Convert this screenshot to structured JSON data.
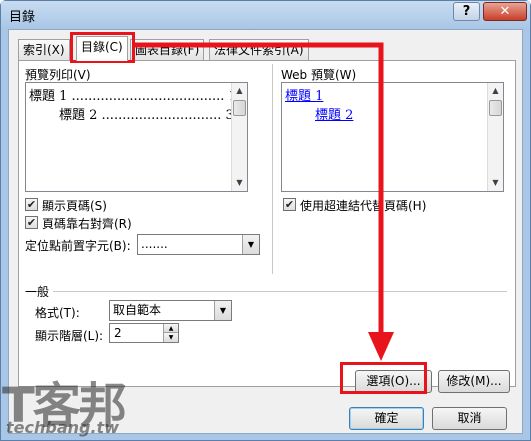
{
  "window": {
    "title": "目錄",
    "help_label": "?",
    "close_label": "✕"
  },
  "tabs": [
    {
      "label": "索引(X)"
    },
    {
      "label": "目錄(C)"
    },
    {
      "label": "圖表目錄(F)"
    },
    {
      "label": "法律文件索引(A)"
    }
  ],
  "print_preview": {
    "label": "預覽列印(V)",
    "entries": [
      {
        "text": "標題 1",
        "dots": ".....................................",
        "page": "1"
      },
      {
        "text": "標題 2",
        "dots": ".............................",
        "page": "3"
      }
    ],
    "show_page_numbers": {
      "label": "顯示頁碼(S)",
      "checked": true
    },
    "right_align": {
      "label": "頁碼靠右對齊(R)",
      "checked": true
    },
    "tab_leader": {
      "label": "定位點前置字元(B):",
      "value": "......."
    }
  },
  "web_preview": {
    "label": "Web 預覽(W)",
    "entries": [
      {
        "text": "標題 1"
      },
      {
        "text": "標題 2"
      }
    ],
    "use_hyperlinks": {
      "label": "使用超連結代替頁碼(H)",
      "checked": true
    }
  },
  "general": {
    "label": "一般",
    "formats": {
      "label": "格式(T):",
      "value": "取自範本"
    },
    "levels": {
      "label": "顯示階層(L):",
      "value": "2"
    }
  },
  "buttons": {
    "options": "選項(O)...",
    "modify": "修改(M)...",
    "ok": "確定",
    "cancel": "取消"
  },
  "watermark": {
    "main": "T客邦",
    "sub": "techbang.tw"
  },
  "colors": {
    "highlight": "#e8141b",
    "link": "#0000ff"
  }
}
